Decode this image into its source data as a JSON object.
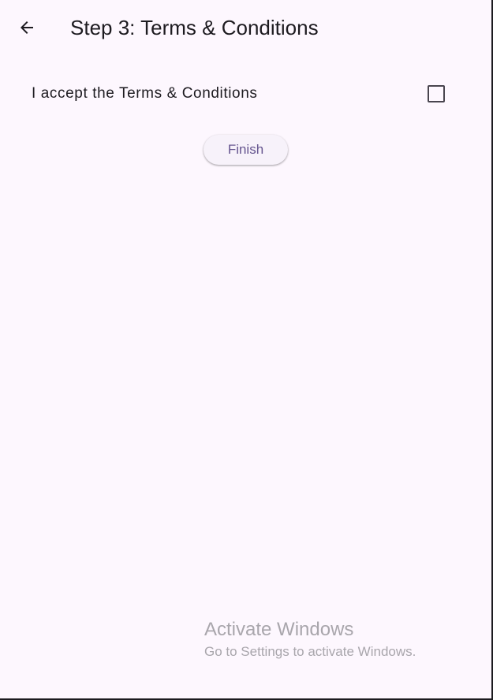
{
  "app_bar": {
    "back_icon": "arrow-left-icon",
    "title": "Step 3: Terms & Conditions"
  },
  "terms": {
    "label": "I accept the Terms & Conditions",
    "checked": false
  },
  "actions": {
    "finish_label": "Finish"
  },
  "watermark": {
    "title": "Activate Windows",
    "subtitle": "Go to Settings to activate Windows."
  },
  "colors": {
    "background": "#fdf7fe",
    "text": "#1d1b20",
    "button_text": "#65558f",
    "button_background": "#f7f2fa"
  }
}
